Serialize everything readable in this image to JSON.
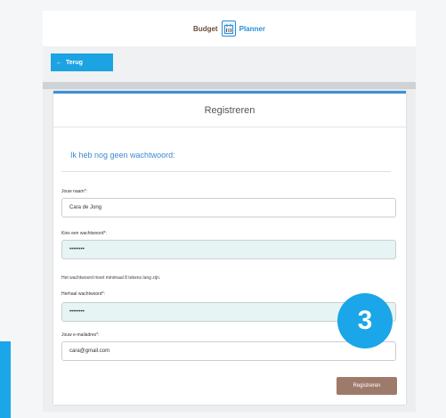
{
  "header": {
    "brand_left": "Budget",
    "brand_right": "Planner",
    "logo_icon": "calendar-logo-icon"
  },
  "nav": {
    "back_label": "Terug",
    "back_icon": "arrow-left-icon"
  },
  "form": {
    "title": "Registreren",
    "section_heading": "Ik heb nog geen wachtwoord:",
    "fields": [
      {
        "label": "Jouw naam*:",
        "value": "Cara de Jong"
      },
      {
        "label": "Kies een wachtwoord*:",
        "value": "••••••••"
      },
      {
        "label": "Herhaal wachtwoord*:",
        "value": "••••••••"
      },
      {
        "label": "Jouw e-mailadres*:",
        "value": "cara@gmail.com"
      }
    ],
    "password_hint": "Het wachtwoord moet minimaal 8 tekens lang zijn.",
    "submit_label": "Registreren"
  },
  "overlay": {
    "step_number": "3"
  },
  "colors": {
    "accent_blue": "#1aa6e8",
    "heading_blue": "#3b8ad1",
    "submit_brown": "#9e7a6b",
    "filled_field": "#e6f4f3"
  }
}
